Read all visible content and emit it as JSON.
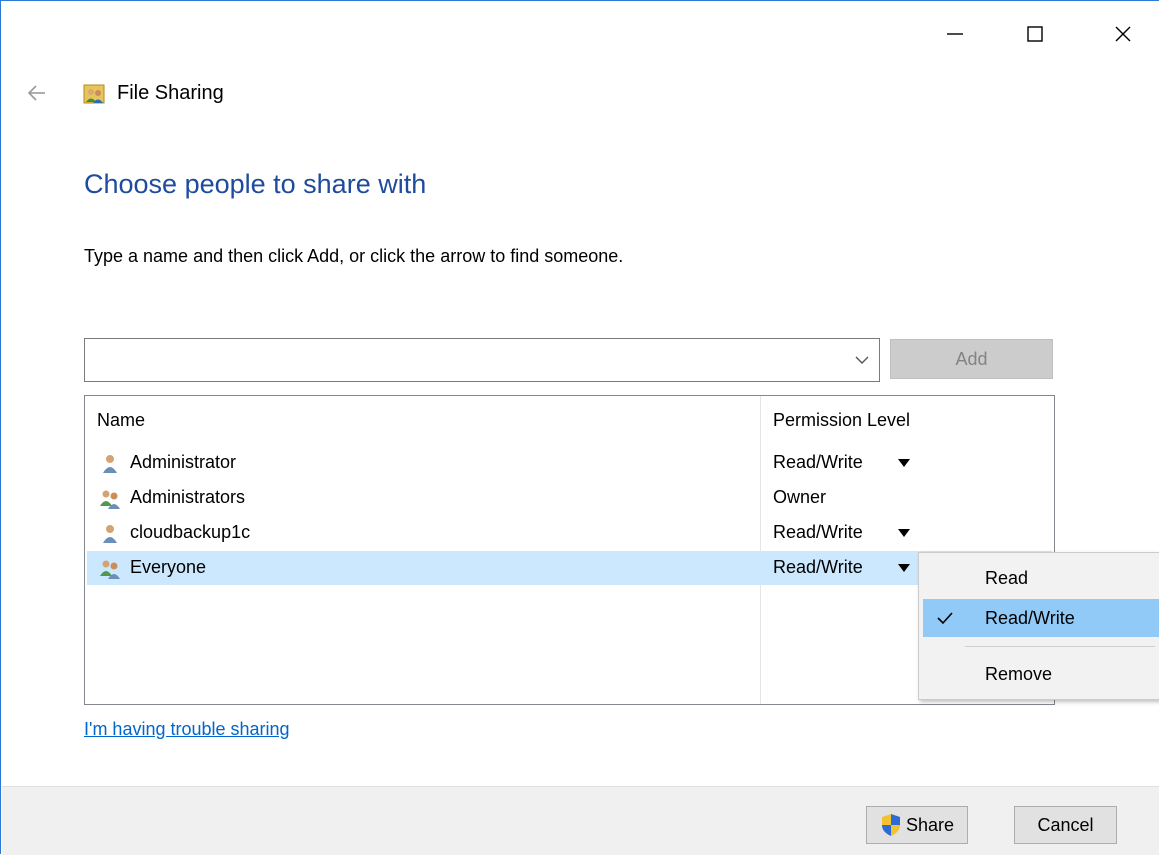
{
  "window": {
    "title": "File Sharing",
    "minimize_glyph": "—",
    "maximize_glyph": "☐",
    "close_glyph": "✕"
  },
  "nav": {
    "back_icon": "back-arrow-icon"
  },
  "main": {
    "heading": "Choose people to share with",
    "instructions": "Type a name and then click Add, or click the arrow to find someone.",
    "name_input": {
      "value": "",
      "placeholder": ""
    },
    "add_label": "Add"
  },
  "list": {
    "columns": [
      "Name",
      "Permission Level"
    ],
    "rows": [
      {
        "name": "Administrator",
        "permission": "Read/Write",
        "icon": "user-icon",
        "has_dropdown": true,
        "selected": false
      },
      {
        "name": "Administrators",
        "permission": "Owner",
        "icon": "group-icon",
        "has_dropdown": false,
        "selected": false
      },
      {
        "name": "cloudbackup1c",
        "permission": "Read/Write",
        "icon": "user-icon",
        "has_dropdown": true,
        "selected": false
      },
      {
        "name": "Everyone",
        "permission": "Read/Write",
        "icon": "group-icon",
        "has_dropdown": true,
        "selected": true
      }
    ]
  },
  "context_menu": {
    "items": [
      {
        "label": "Read",
        "checked": false,
        "highlighted": false
      },
      {
        "label": "Read/Write",
        "checked": true,
        "highlighted": true
      },
      {
        "label": "Remove",
        "checked": false,
        "highlighted": false
      }
    ]
  },
  "trouble_link": "I'm having trouble sharing",
  "footer": {
    "share_label": "Share",
    "cancel_label": "Cancel"
  },
  "colors": {
    "heading": "#1f4b9e",
    "link": "#0066cc",
    "selection": "#cce8ff",
    "menu_highlight": "#91c9f7",
    "window_border": "#2b79d8"
  }
}
